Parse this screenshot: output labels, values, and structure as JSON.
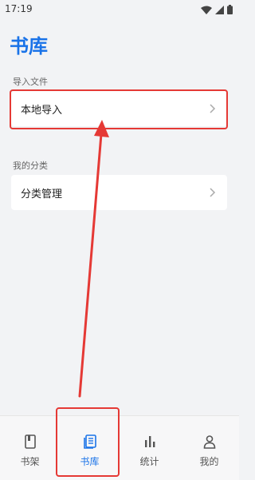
{
  "status_bar": {
    "time": "17:19",
    "icons": [
      "wifi-icon",
      "signal-icon",
      "battery-icon"
    ]
  },
  "header": {
    "title": "书库"
  },
  "sections": [
    {
      "label": "导入文件",
      "items": [
        {
          "label": "本地导入",
          "icon": "chevron-right-icon",
          "highlighted": true
        }
      ]
    },
    {
      "label": "我的分类",
      "items": [
        {
          "label": "分类管理",
          "icon": "chevron-right-icon",
          "highlighted": false
        }
      ]
    }
  ],
  "tab_bar": {
    "active_index": 1,
    "tabs": [
      {
        "label": "书架",
        "icon": "bookshelf-icon"
      },
      {
        "label": "书库",
        "icon": "library-icon"
      },
      {
        "label": "统计",
        "icon": "stats-icon"
      },
      {
        "label": "我的",
        "icon": "profile-icon"
      }
    ]
  },
  "colors": {
    "accent": "#1a73e8",
    "annotation": "#e53935",
    "background": "#f2f3f5"
  }
}
